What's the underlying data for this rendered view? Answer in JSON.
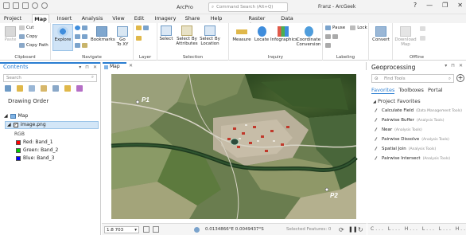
{
  "window": {
    "app_title": "ArcPro",
    "search_placeholder": "Command Search (Alt+Q)",
    "user": "Franz - ArcGeek",
    "controls": [
      "?",
      "—",
      "❐",
      "✕"
    ]
  },
  "menu_tabs": [
    "Project",
    "Map",
    "Insert",
    "Analysis",
    "View",
    "Edit",
    "Imagery",
    "Share",
    "Help",
    "Raster Layer",
    "Data"
  ],
  "ribbon": {
    "clipboard": {
      "label": "Clipboard",
      "paste": "Paste",
      "cut": "Cut",
      "copy": "Copy",
      "copy_path": "Copy Path"
    },
    "navigate": {
      "label": "Navigate",
      "explore": "Explore",
      "bookmarks": "Bookmarks",
      "goto_line1": "Go",
      "goto_line2": "To XY"
    },
    "layer": {
      "label": "Layer"
    },
    "selection": {
      "label": "Selection",
      "select": "Select",
      "by_attr_line1": "Select By",
      "by_attr_line2": "Attributes",
      "by_loc_line1": "Select By",
      "by_loc_line2": "Location"
    },
    "inquiry": {
      "label": "Inquiry",
      "measure": "Measure",
      "locate": "Locate",
      "infographics": "Infographics",
      "coord_line1": "Coordinate",
      "coord_line2": "Conversion"
    },
    "labeling": {
      "label": "Labeling",
      "pause": "Pause",
      "lock": "Lock"
    },
    "convert": {
      "label": "Convert"
    },
    "offline": {
      "label": "Offline",
      "download_line1": "Download",
      "download_line2": "Map"
    }
  },
  "contents": {
    "title": "Contents",
    "search_placeholder": "Search",
    "drawing_order": "Drawing Order",
    "map_item": "Map",
    "layer_item": "image.png",
    "rgb_label": "RGB",
    "bands": [
      {
        "label": "Red:  Band_1",
        "color": "#ff0000"
      },
      {
        "label": "Green: Band_2",
        "color": "#00cc00"
      },
      {
        "label": "Blue:  Band_3",
        "color": "#0000ff"
      }
    ]
  },
  "map": {
    "tab": "Map",
    "labels": [
      "P1",
      "P2"
    ],
    "scale": "1:8 703",
    "coords": "0.0134866°E 0.0049437°S",
    "selected": "Selected Features: 0"
  },
  "geoprocessing": {
    "title": "Geoprocessing",
    "find_placeholder": "Find Tools",
    "tabs": [
      "Favorites",
      "Toolboxes",
      "Portal"
    ],
    "section": "Project Favorites",
    "tools": [
      {
        "name": "Calculate Field",
        "box": "(Data Management Tools)"
      },
      {
        "name": "Pairwise Buffer",
        "box": "(Analysis Tools)"
      },
      {
        "name": "Near",
        "box": "(Analysis Tools)"
      },
      {
        "name": "Pairwise Dissolve",
        "box": "(Analysis Tools)"
      },
      {
        "name": "Spatial Join",
        "box": "(Analysis Tools)"
      },
      {
        "name": "Pairwise Intersect",
        "box": "(Analysis Tools)"
      }
    ],
    "bottom_bar": "C... L... H... L... L... H... L... C... C... Ca..."
  }
}
